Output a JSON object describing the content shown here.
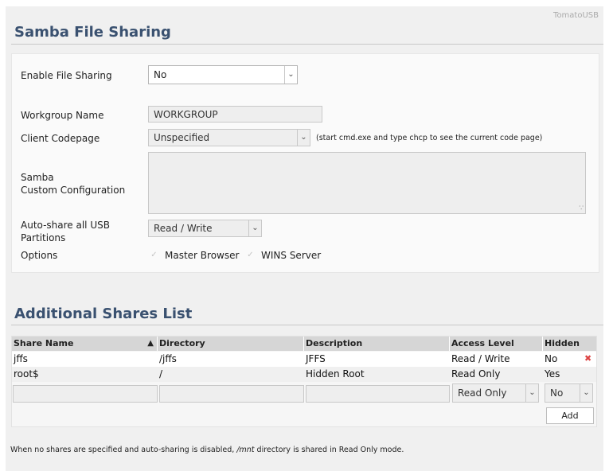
{
  "brand": "TomatoUSB",
  "samba": {
    "title": "Samba File Sharing",
    "enable_label": "Enable File Sharing",
    "enable_value": "No",
    "workgroup_label": "Workgroup Name",
    "workgroup_value": "WORKGROUP",
    "codepage_label": "Client Codepage",
    "codepage_value": "Unspecified",
    "codepage_hint": "(start cmd.exe and type chcp to see the current code page)",
    "custom_label_line1": "Samba",
    "custom_label_line2": "Custom Configuration",
    "custom_value": "",
    "autoshare_label_line1": "Auto-share all USB",
    "autoshare_label_line2": "Partitions",
    "autoshare_value": "Read / Write",
    "options_label": "Options",
    "option_master_browser": "Master Browser",
    "option_wins_server": "WINS Server"
  },
  "shares": {
    "title": "Additional Shares List",
    "columns": [
      "Share Name",
      "Directory",
      "Description",
      "Access Level",
      "Hidden"
    ],
    "sort_indicator": "▲",
    "rows": [
      {
        "name": "jffs",
        "directory": "/jffs",
        "description": "JFFS",
        "access": "Read / Write",
        "hidden": "No"
      },
      {
        "name": "root$",
        "directory": "/",
        "description": "Hidden Root",
        "access": "Read Only",
        "hidden": "Yes"
      }
    ],
    "new_access_value": "Read Only",
    "new_hidden_value": "No",
    "add_label": "Add",
    "delete_glyph": "✖"
  },
  "footnote": {
    "before": "When no shares are specified and auto-sharing is disabled, ",
    "path": "/mnt",
    "after": " directory is shared in Read Only mode."
  }
}
